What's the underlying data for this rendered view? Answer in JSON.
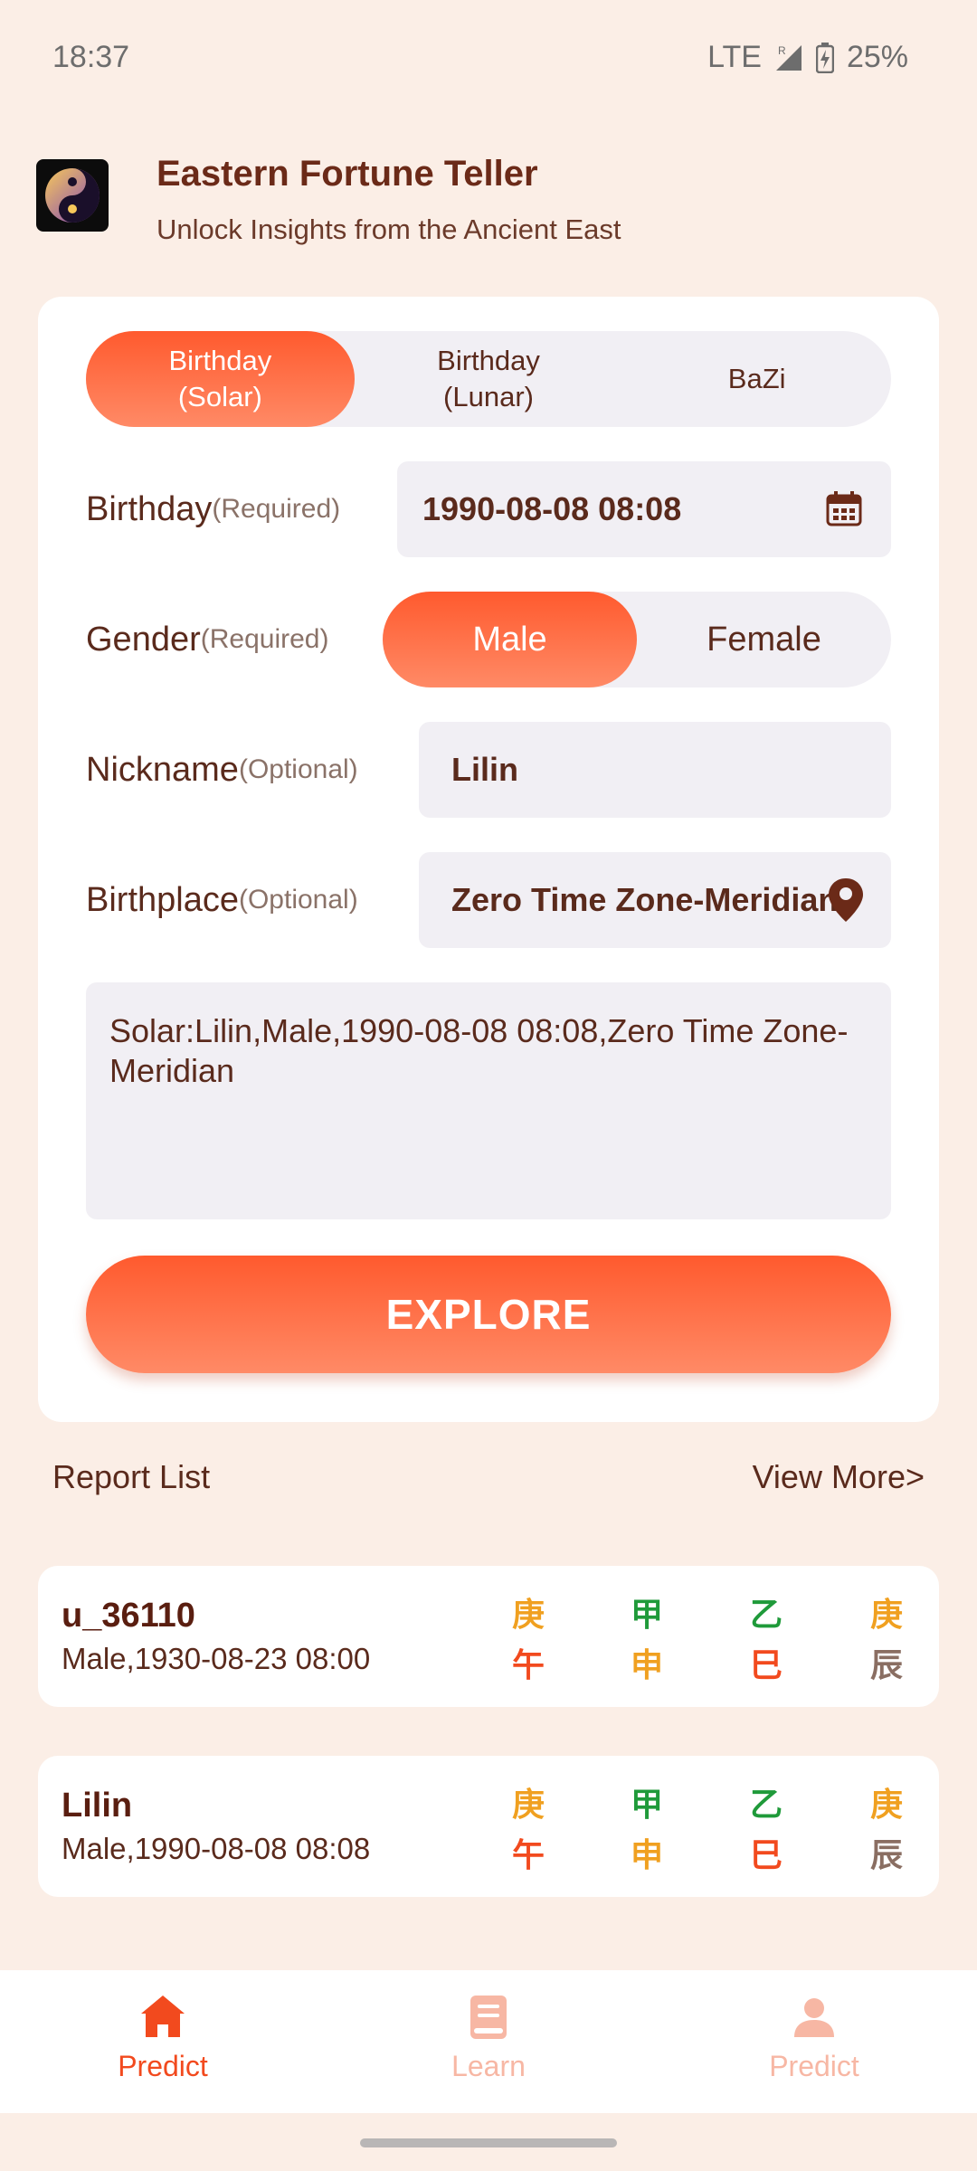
{
  "status": {
    "time": "18:37",
    "network": "LTE",
    "roaming": "R",
    "battery": "25%"
  },
  "header": {
    "title": "Eastern Fortune Teller",
    "subtitle": "Unlock Insights from the Ancient East"
  },
  "tabs": [
    {
      "label": "Birthday\n(Solar)",
      "active": true
    },
    {
      "label": "Birthday\n(Lunar)",
      "active": false
    },
    {
      "label": "BaZi",
      "active": false
    }
  ],
  "form": {
    "birthday": {
      "label": "Birthday",
      "hint": "(Required)",
      "value": "1990-08-08 08:08"
    },
    "gender": {
      "label": "Gender",
      "hint": "(Required)",
      "options": [
        "Male",
        "Female"
      ],
      "selected": "Male"
    },
    "nickname": {
      "label": "Nickname",
      "hint": "(Optional)",
      "value": "Lilin"
    },
    "birthplace": {
      "label": "Birthplace",
      "hint": "(Optional)",
      "value": "Zero Time Zone-Meridian"
    },
    "summary": "Solar:Lilin,Male,1990-08-08 08:08,Zero Time Zone-Meridian",
    "explore_label": "EXPLORE"
  },
  "reports": {
    "title": "Report List",
    "view_more": "View More>",
    "items": [
      {
        "name": "u_36110",
        "info": "Male,1930-08-23 08:00",
        "pillars": [
          {
            "top": "庚",
            "top_color": "#f0a020",
            "bottom": "午",
            "bottom_color": "#f24a1e"
          },
          {
            "top": "甲",
            "top_color": "#1f9a3a",
            "bottom": "申",
            "bottom_color": "#f0a020"
          },
          {
            "top": "乙",
            "top_color": "#1f9a3a",
            "bottom": "巳",
            "bottom_color": "#f24a1e"
          },
          {
            "top": "庚",
            "top_color": "#f0a020",
            "bottom": "辰",
            "bottom_color": "#8a6e62"
          }
        ]
      },
      {
        "name": "Lilin",
        "info": "Male,1990-08-08 08:08",
        "pillars": [
          {
            "top": "庚",
            "top_color": "#f0a020",
            "bottom": "午",
            "bottom_color": "#f24a1e"
          },
          {
            "top": "甲",
            "top_color": "#1f9a3a",
            "bottom": "申",
            "bottom_color": "#f0a020"
          },
          {
            "top": "乙",
            "top_color": "#1f9a3a",
            "bottom": "巳",
            "bottom_color": "#f24a1e"
          },
          {
            "top": "庚",
            "top_color": "#f0a020",
            "bottom": "辰",
            "bottom_color": "#8a6e62"
          }
        ]
      }
    ]
  },
  "nav": [
    {
      "label": "Predict",
      "icon": "home-icon",
      "active": true
    },
    {
      "label": "Learn",
      "icon": "book-icon",
      "active": false
    },
    {
      "label": "Predict",
      "icon": "person-icon",
      "active": false
    }
  ],
  "colors": {
    "accent": "#ff5a2e",
    "background": "#fbeee6",
    "text": "#5a2a1c"
  }
}
